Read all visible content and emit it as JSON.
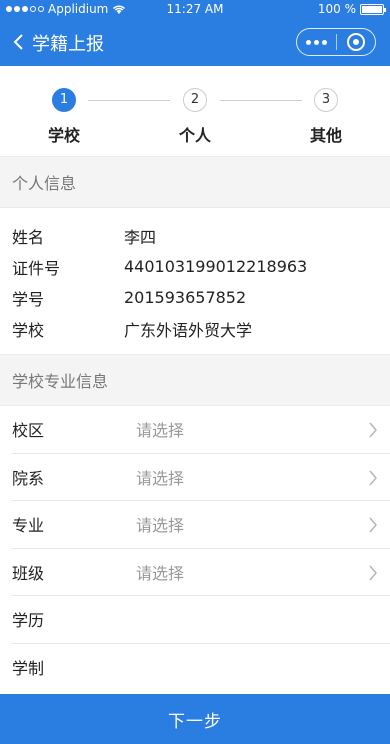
{
  "status_bar": {
    "carrier": "Applidium",
    "time": "11:27 AM",
    "battery": "100 %"
  },
  "nav": {
    "back_icon": "chevron-left-icon",
    "title": "学籍上报"
  },
  "steps": [
    {
      "number": "1",
      "label": "学校",
      "active": true
    },
    {
      "number": "2",
      "label": "个人",
      "active": false
    },
    {
      "number": "3",
      "label": "其他",
      "active": false
    }
  ],
  "personal_section": {
    "title": "个人信息",
    "rows": [
      {
        "label": "姓名",
        "value": "李四"
      },
      {
        "label": "证件号",
        "value": "440103199012218963"
      },
      {
        "label": "学号",
        "value": "201593657852"
      },
      {
        "label": "学校",
        "value": "广东外语外贸大学"
      }
    ]
  },
  "school_section": {
    "title": "学校专业信息",
    "rows": [
      {
        "label": "校区",
        "value": "请选择",
        "chevron": true
      },
      {
        "label": "院系",
        "value": "请选择",
        "chevron": true
      },
      {
        "label": "专业",
        "value": "请选择",
        "chevron": true
      },
      {
        "label": "班级",
        "value": "请选择",
        "chevron": true
      },
      {
        "label": "学历",
        "value": "",
        "chevron": false
      },
      {
        "label": "学制",
        "value": "",
        "chevron": false
      }
    ]
  },
  "next_button": "下一步",
  "colors": {
    "primary": "#2a7de1",
    "section_bg": "#f4f4f4",
    "placeholder": "#999999"
  }
}
